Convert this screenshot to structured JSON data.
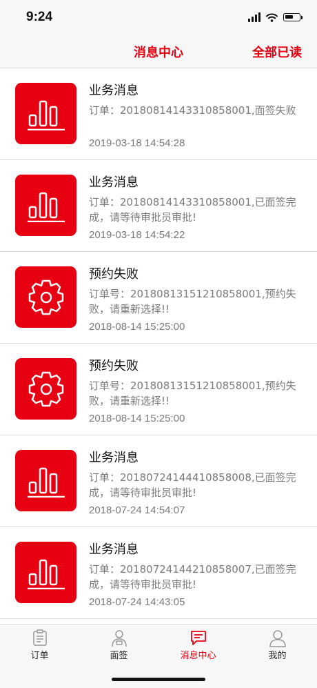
{
  "status_bar": {
    "time": "9:24"
  },
  "nav": {
    "title": "消息中心",
    "right_action": "全部已读"
  },
  "messages": [
    {
      "icon": "bar-chart-icon",
      "title": "业务消息",
      "body": "订单：2018081414331085800​1,面签失败",
      "time": "2019-03-18 14:54:28"
    },
    {
      "icon": "bar-chart-icon",
      "title": "业务消息",
      "body": "订单：2018081414331085800​1,已面签完成，请等待审批员审批!",
      "time": "2019-03-18 14:54:22"
    },
    {
      "icon": "gear-icon",
      "title": "预约失败",
      "body": "订单号：2018081315121085800​1,预约失败，请重新选择!!",
      "time": "2018-08-14 15:25:00"
    },
    {
      "icon": "gear-icon",
      "title": "预约失败",
      "body": "订单号：2018081315121085800​1,预约失败，请重新选择!!",
      "time": "2018-08-14 15:25:00"
    },
    {
      "icon": "bar-chart-icon",
      "title": "业务消息",
      "body": "订单：2018072414441085800​8,已面签完成，请等待审批员审批!",
      "time": "2018-07-24 14:54:07"
    },
    {
      "icon": "bar-chart-icon",
      "title": "业务消息",
      "body": "订单：2018072414421085800​7,已面签完成，请等待审批员审批!",
      "time": "2018-07-24 14:43:05"
    }
  ],
  "tabs": [
    {
      "label": "订单",
      "icon": "clipboard-icon"
    },
    {
      "label": "面签",
      "icon": "person-sign-icon"
    },
    {
      "label": "消息中心",
      "icon": "message-icon",
      "active": true
    },
    {
      "label": "我的",
      "icon": "user-icon"
    }
  ],
  "colors": {
    "accent": "#e60012",
    "text_secondary": "#7a7a7a"
  }
}
